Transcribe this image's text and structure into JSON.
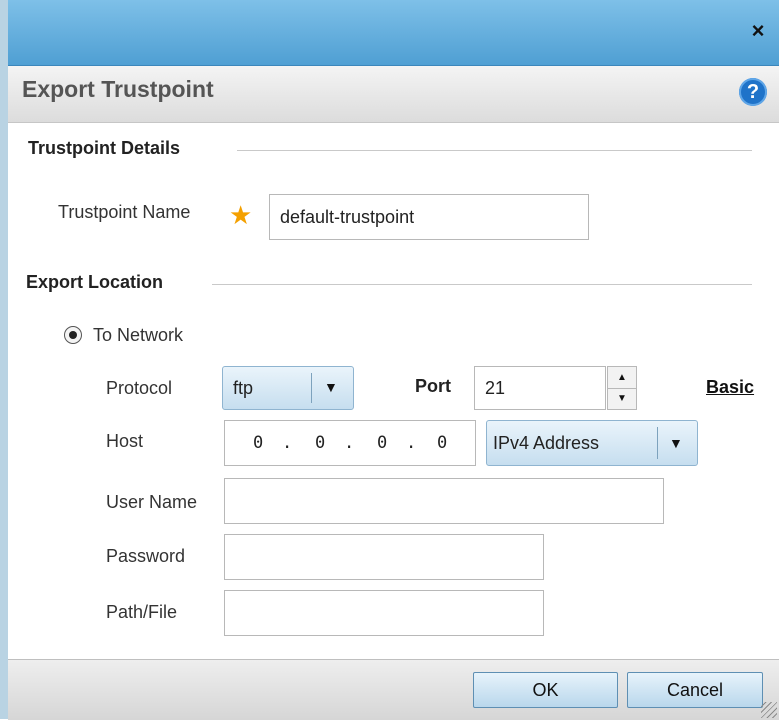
{
  "dialog": {
    "close_glyph": "×",
    "title": "Export Trustpoint",
    "help_glyph": "?"
  },
  "trustpoint_details": {
    "section_title": "Trustpoint Details",
    "name_label": "Trustpoint Name",
    "name_value": "default-trustpoint",
    "required_glyph": "★"
  },
  "export_location": {
    "section_title": "Export Location",
    "destination_option": "To Network",
    "protocol_label": "Protocol",
    "protocol_value": "ftp",
    "port_label": "Port",
    "port_value": "21",
    "basic_link": "Basic",
    "host_label": "Host",
    "host_octets": [
      "0",
      "0",
      "0",
      "0"
    ],
    "host_dots": [
      ".",
      ".",
      "."
    ],
    "address_type": "IPv4 Address",
    "user_name_label": "User Name",
    "user_name_value": "",
    "password_label": "Password",
    "password_value": "",
    "path_label": "Path/File",
    "path_value": ""
  },
  "footer": {
    "ok_label": "OK",
    "cancel_label": "Cancel"
  },
  "icons": {
    "close": "close-icon",
    "help": "help-icon",
    "required": "required-star-icon",
    "dropdown": "chevron-down-icon",
    "spinner_up": "spinner-up-icon",
    "spinner_down": "spinner-down-icon"
  },
  "colors": {
    "titlebar": "#5aa8dc",
    "help_icon": "#1f73c9",
    "required_star": "#f4a000",
    "button_gradient_bottom": "#b9d7ec"
  }
}
